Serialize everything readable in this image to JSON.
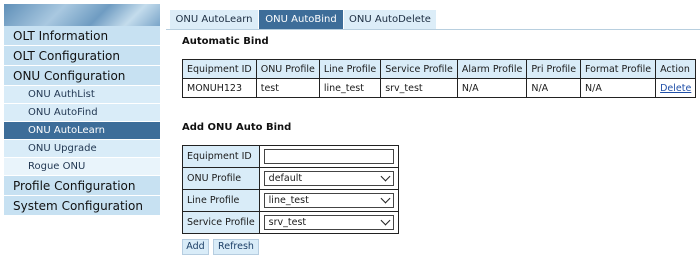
{
  "sidebar": {
    "items": [
      {
        "label": "OLT Information"
      },
      {
        "label": "OLT Configuration"
      },
      {
        "label": "ONU Configuration"
      },
      {
        "label": "ONU AuthList"
      },
      {
        "label": "ONU AutoFind"
      },
      {
        "label": "ONU AutoLearn"
      },
      {
        "label": "ONU Upgrade"
      },
      {
        "label": "Rogue ONU"
      },
      {
        "label": "Profile Configuration"
      },
      {
        "label": "System Configuration"
      }
    ]
  },
  "tabs": [
    {
      "label": "ONU AutoLearn"
    },
    {
      "label": "ONU AutoBind"
    },
    {
      "label": "ONU AutoDelete"
    }
  ],
  "auto_bind": {
    "title": "Automatic Bind",
    "columns": [
      "Equipment ID",
      "ONU Profile",
      "Line Profile",
      "Service Profile",
      "Alarm Profile",
      "Pri Profile",
      "Format Profile",
      "Action"
    ],
    "rows": [
      [
        "MONUH123",
        "test",
        "line_test",
        "srv_test",
        "N/A",
        "N/A",
        "N/A",
        "Delete"
      ]
    ]
  },
  "add_form": {
    "title": "Add ONU Auto Bind",
    "fields": [
      {
        "label": "Equipment ID",
        "value": ""
      },
      {
        "label": "ONU Profile",
        "value": "default"
      },
      {
        "label": "Line Profile",
        "value": "line_test"
      },
      {
        "label": "Service Profile",
        "value": "srv_test"
      }
    ],
    "add_label": "Add",
    "refresh_label": "Refresh"
  }
}
